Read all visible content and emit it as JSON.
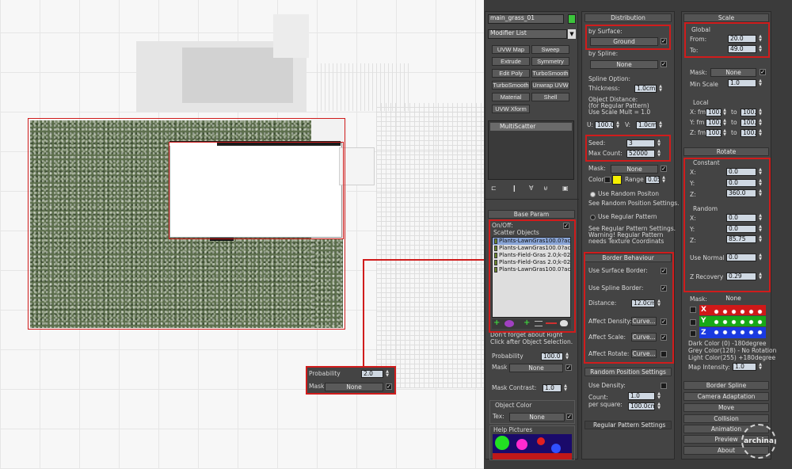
{
  "viewport": {
    "label_probability": "Probability",
    "probability_value": "2.0",
    "label_mask": "Mask",
    "mask_value": "None"
  },
  "modifier_panel": {
    "object_name": "main_grass_01",
    "object_color": "#3cc43c",
    "modifier_list": "Modifier List",
    "buttons": [
      "UVW Map",
      "Sweep",
      "Extrude",
      "Symmetry",
      "Edit Poly",
      "TurboSmooth",
      "TurboSmooth",
      "Unwrap UVW",
      "Material",
      "Shell",
      "UVW Xform"
    ],
    "stack_item": "MultiScatter"
  },
  "base_param": {
    "title": "Base Param",
    "on_off": "On/Off:",
    "scatter_objects": "Scatter Objects",
    "objects": [
      "Plants-LawnGras100.0?ack0",
      "Plants-LawnGras100.0?ack0",
      "Plants-Field-Gras 2.0;k-027",
      "Plants-Field-Gras 2.0;k-026",
      "Plants-LawnGras100.0?ack0"
    ],
    "hint": "Don't forget about Right Click after Object Selection.",
    "probability_label": "Probability",
    "probability_value": "100.0",
    "mask_label": "Mask",
    "mask_value": "None",
    "mask_contrast_label": "Mask Contrast:",
    "mask_contrast_value": "1.0",
    "object_color_title": "Object Color",
    "tex_label": "Tex:",
    "tex_value": "None",
    "help_pictures": "Help Pictures"
  },
  "distribution": {
    "title": "Distribution",
    "by_surface": "by Surface:",
    "surface_value": "Ground",
    "by_spline": "by Spline:",
    "spline_value": "None",
    "spline_option": "Spline Option:",
    "thickness_label": "Thickness:",
    "thickness_value": "1.0cm",
    "object_distance_1": "Object Distance:",
    "object_distance_2": "(for Regular Pattern)",
    "object_distance_3": "Use Scale Mult = 1.0",
    "u_label": "U:",
    "u_value": "100.0cm",
    "v_label": "V:",
    "v_value": "1.0cm",
    "seed_label": "Seed:",
    "seed_value": "3",
    "max_count_label": "Max Count:",
    "max_count_value": "52000",
    "mask_label": "Mask:",
    "mask_value": "None",
    "color_label": "Color",
    "color_swatch": "#f5f000",
    "range_label": "Range",
    "range_value": "0.05",
    "use_random": "Use Random Positon",
    "random_note": "See Random Position Settings.",
    "use_regular": "Use Regular Pattern",
    "regular_note_1": "See Regular Pattern Settings.",
    "regular_note_2": "Warning! Regular Pattern",
    "regular_note_3": "needs Texture Coordinats"
  },
  "border_behaviour": {
    "title": "Border Behaviour",
    "use_surface_border": "Use Surface Border:",
    "use_spline_border": "Use Spline Border:",
    "distance_label": "Distance:",
    "distance_value": "12.0cm",
    "affect_density": "Affect Density:",
    "affect_scale": "Affect Scale:",
    "affect_rotate": "Affect Rotate:",
    "curve_btn": "Curve..."
  },
  "random_position": {
    "title": "Random Position Settings",
    "use_density": "Use Density:",
    "count_label_1": "Count:",
    "count_label_2": "per square:",
    "count_value": "1.0",
    "per_square_value": "100.0cm"
  },
  "regular_pattern": {
    "title": "Regular Pattern Settings"
  },
  "scale": {
    "title": "Scale",
    "global": "Global",
    "from_label": "From:",
    "from_value": "20.0",
    "to_label": "To:",
    "to_value": "49.0",
    "mask_label": "Mask:",
    "mask_value": "None",
    "min_scale_label": "Min Scale",
    "min_scale_value": "1.0",
    "local": "Local",
    "x_fm": "X: fm",
    "y_fm": "Y: fm",
    "z_fm": "Z: fm",
    "to": "to",
    "local_from": "100.0",
    "local_to": "100.0"
  },
  "rotate": {
    "title": "Rotate",
    "constant": "Constant",
    "x_label": "X:",
    "y_label": "Y:",
    "z_label": "Z:",
    "cx": "0.0",
    "cy": "0.0",
    "cz": "360.0",
    "random": "Random",
    "rx": "0.0",
    "ry": "0.0",
    "rz": "85.75",
    "use_normal_label": "Use Normal",
    "use_normal_value": "0.0",
    "z_recovery_label": "Z Recovery",
    "z_recovery_value": "0.29",
    "mask_label": "Mask:",
    "mask_value": "None",
    "dark_color": "Dark Color (0)    -180degree",
    "grey_color": "Grey Color(128)  - No Rotation",
    "light_color": "Light Color(255)   +180degree",
    "map_intensity_label": "Map Intensity:",
    "map_intensity_value": "1.0"
  },
  "bottom_buttons": [
    "Border Spline",
    "Camera Adaptation",
    "Move",
    "Collision",
    "Animation",
    "Preview",
    "About"
  ],
  "watermark": "archina"
}
